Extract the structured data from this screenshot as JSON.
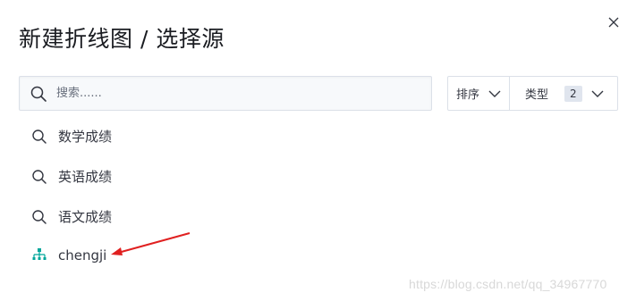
{
  "modal": {
    "title": "新建折线图 / 选择源",
    "close_icon": "close-icon"
  },
  "search": {
    "placeholder": "搜索......",
    "value": "",
    "icon": "search-icon"
  },
  "filters": {
    "sort_label": "排序",
    "type_label": "类型",
    "type_count": "2"
  },
  "sources": [
    {
      "label": "数学成绩",
      "icon": "search-icon"
    },
    {
      "label": "英语成绩",
      "icon": "search-icon"
    },
    {
      "label": "语文成绩",
      "icon": "search-icon"
    },
    {
      "label": "chengji",
      "icon": "index-pattern-icon"
    }
  ],
  "colors": {
    "index_icon": "#00a69b",
    "annotation_arrow": "#e02020"
  },
  "watermark": "https://blog.csdn.net/qq_34967770"
}
